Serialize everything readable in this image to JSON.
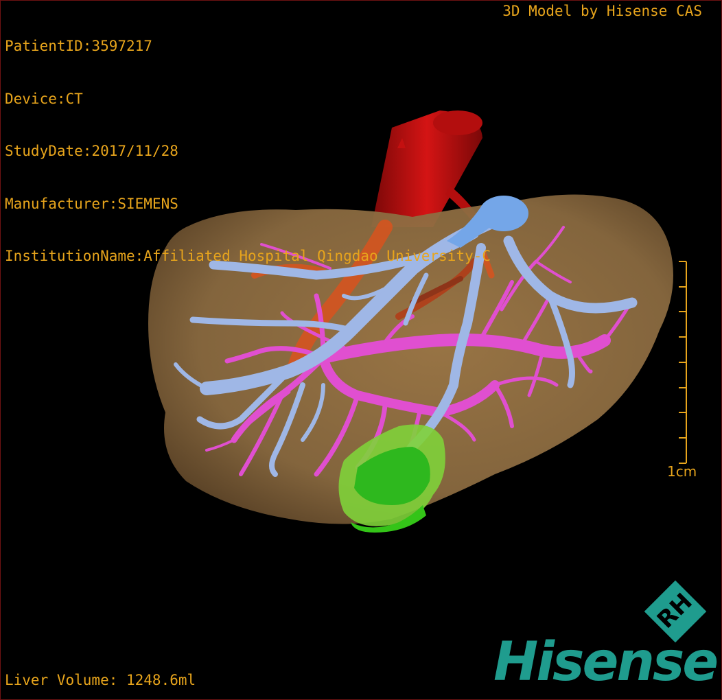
{
  "header": {
    "patient_id": "PatientID:3597217",
    "device": "Device:CT",
    "study_date": "StudyDate:2017/11/28",
    "manufacturer": "Manufacturer:SIEMENS",
    "institution": "InstitutionName:Affiliated Hospital Qingdao University-C"
  },
  "credit": "3D Model by Hisense CAS",
  "scale_bar": {
    "label": "1cm",
    "ticks": 9
  },
  "footer": {
    "liver_volume": "Liver Volume: 1248.6ml"
  },
  "logo": {
    "wordmark": "Hisense",
    "badge": "RH"
  },
  "colors": {
    "text": "#e8a51c",
    "liver": "#8a6a40",
    "artery": "#c41010",
    "portal_vein": "#e04fd0",
    "hepatic_vein": "#9fb7e6",
    "tumor": "#39c21e",
    "logo": "#1f9c8e"
  }
}
